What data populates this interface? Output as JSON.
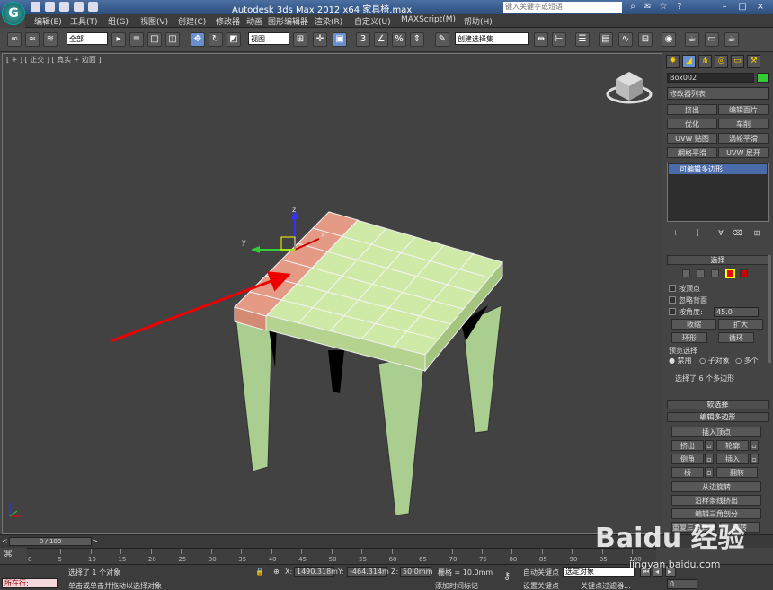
{
  "title": "Autodesk 3ds Max  2012 x64    家具椅.max",
  "search_placeholder": "键入关键字或短语",
  "menu": [
    "编辑(E)",
    "工具(T)",
    "组(G)",
    "视图(V)",
    "创建(C)",
    "修改器",
    "动画",
    "图形编辑器",
    "渲染(R)",
    "自定义(U)",
    "MAXScript(M)",
    "帮助(H)"
  ],
  "toolbar": {
    "selection_filter": "全部",
    "ref_coord": "视图",
    "named_sel": "创建选择集"
  },
  "viewport": {
    "label": "[ + ] [ 正交 ] [ 真实 + 边面 ]",
    "axis_x": "x",
    "axis_y": "y",
    "axis_z": "z"
  },
  "cmd": {
    "object_name": "Box002",
    "object_color": "#33cc33",
    "modifier_list": "修改器列表",
    "mod_buttons": [
      "挤出",
      "编辑面片",
      "优化",
      "车削",
      "UVW 贴图",
      "涡轮平滑",
      "網格平滑",
      "UVW 展开"
    ],
    "stack_item": "可编辑多边形",
    "sel_header": "选择",
    "by_vertex": "按顶点",
    "ignore_back": "忽略背面",
    "by_angle": "按角度:",
    "angle_val": "45.0",
    "shrink": "收缩",
    "grow": "扩大",
    "ring": "环形",
    "loop": "循环",
    "preview": "预览选择",
    "off": "禁用",
    "subobj": "子对象",
    "multi": "多个",
    "sel_count": "选择了 6 个多边形",
    "soft_sel": "软选择",
    "edit_poly": "编辑多边形",
    "insert_vertex": "插入顶点",
    "extrude": "挤出",
    "outline": "轮廓",
    "bevel": "倒角",
    "inset": "插入",
    "bridge": "桥",
    "flip": "翻转",
    "hinge": "从边旋转",
    "extrude_spline": "沿样条线挤出",
    "edit_tri": "编辑三角剖分",
    "retri": "重复三角算法",
    "turn": "旋转"
  },
  "timeline": {
    "slider": "0 / 100",
    "ticks": [
      "0",
      "5",
      "10",
      "15",
      "20",
      "25",
      "30",
      "35",
      "40",
      "45",
      "50",
      "55",
      "60",
      "65",
      "70",
      "75",
      "80",
      "85",
      "90",
      "95",
      "100"
    ]
  },
  "status": {
    "left_label": "所在行:",
    "selected": "选择了 1 个对象",
    "hint": "单击或单击并拖动以选择对象",
    "x_label": "X:",
    "x_val": "1490.318m",
    "y_label": "Y:",
    "y_val": "-464.314m",
    "z_label": "Z:",
    "z_val": "50.0mm",
    "grid": "栅格 = 10.0mm",
    "add_tag": "添加时间标记",
    "auto_key": "自动关键点",
    "set_key": "设置关键点",
    "key_mode": "选定对象",
    "key_filter": "关键点过滤器...",
    "frame": "0"
  },
  "watermark": "Baidu 经验",
  "watermark_url": "jingyan.baidu.com"
}
